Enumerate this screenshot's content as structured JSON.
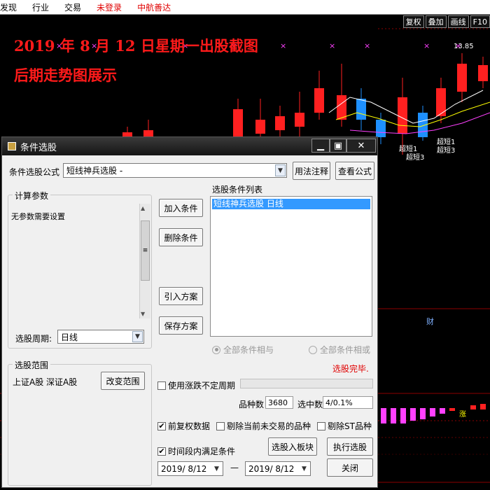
{
  "menu": [
    "发现",
    "行业",
    "交易",
    "未登录",
    "中航善达"
  ],
  "toolbar": [
    "复权",
    "叠加",
    "画线",
    "F10"
  ],
  "chart": {
    "headline1": "2019 年 8 月 12 日星期一出股截图",
    "headline2": "后期走势图展示",
    "price_label": "13.85",
    "marker_finance": "财",
    "marker_rise": "涨",
    "signals": [
      "超短1",
      "超短3",
      "超短1",
      "超短3"
    ],
    "colors": {
      "up": "#ff2020",
      "down": "#1e90ff",
      "ma1": "#ffffff",
      "ma2": "#ffff00",
      "ma3": "#ff40ff"
    }
  },
  "dialog": {
    "title": "条件选股",
    "formula_label": "条件选股公式",
    "formula_value": "短线神兵选股 -",
    "usage_button": "用法注释",
    "view_formula_button": "查看公式",
    "calc_params_title": "计算参数",
    "no_params_text": "无参数需要设置",
    "period_label": "选股周期:",
    "period_value": "日线",
    "add_condition": "加入条件",
    "delete_condition": "删除条件",
    "import_plan": "引入方案",
    "save_plan": "保存方案",
    "condition_list_title": "选股条件列表",
    "condition_items": [
      "短线神兵选股  日线"
    ],
    "radio_all_and": "全部条件相与",
    "radio_all_or": "全部条件相或",
    "status": "选股完毕.",
    "range_title": "选股范围",
    "range_value": "上证A股  深证A股",
    "change_range": "改变范围",
    "use_irregular_period": "使用涨跌不定周期",
    "stock_count_label": "品种数",
    "stock_count_value": "3680",
    "selected_count_label": "选中数",
    "selected_count_value": "4/0.1%",
    "forward_adjust": "前复权数据",
    "exclude_untraded": "剔除当前未交易的品种",
    "exclude_st": "剔除ST品种",
    "time_range_condition": "时间段内满足条件",
    "add_to_board": "选股入板块",
    "execute": "执行选股",
    "date_from": "2019/ 8/12",
    "date_sep": "—",
    "date_to": "2019/ 8/12",
    "close": "关闭",
    "checked": {
      "forward_adjust": true,
      "exclude_untraded": false,
      "exclude_st": false,
      "time_range_condition": true,
      "use_irregular_period": false
    }
  }
}
